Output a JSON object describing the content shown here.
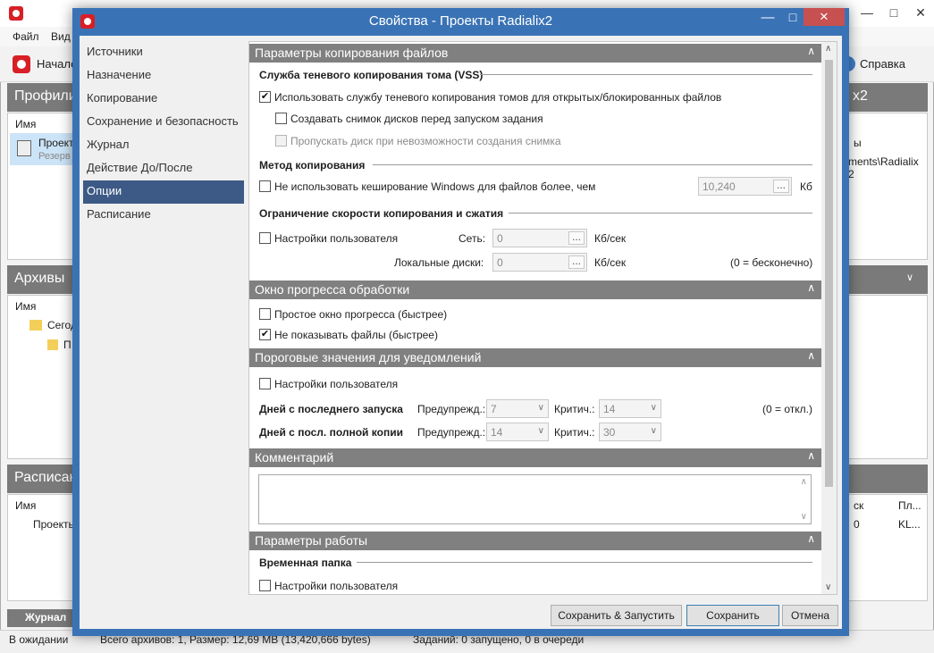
{
  "background": {
    "menu": [
      "Файл",
      "Вид"
    ],
    "toolbar": {
      "start": "Начало",
      "help": "Справка"
    },
    "profiles": {
      "header": "Профили",
      "header_tail": "x2",
      "col_name": "Имя",
      "item_name": "Проект",
      "item_sub": "Резерв",
      "right_col1": "ы",
      "right_col2": "ments\\Radialix 2"
    },
    "archives": {
      "header": "Архивы",
      "col_name": "Имя",
      "tree_item1": "Сегод",
      "tree_item2": "П"
    },
    "schedule": {
      "header": "Расписан",
      "col_name": "Имя",
      "item": "Проекть",
      "right_col1": "ск",
      "right_col2": "Пл...",
      "right_val1": "0",
      "right_val2": "KL..."
    },
    "journal": "Журнал",
    "status": {
      "left": "В ожидании",
      "mid": "Всего архивов: 1, Размер: 12,69 MB (13,420,666 bytes)",
      "right": "Заданий: 0 запущено, 0 в очереди"
    }
  },
  "dialog": {
    "title": "Свойства - Проекты Radialix2",
    "nav": [
      "Источники",
      "Назначение",
      "Копирование",
      "Сохранение и безопасность",
      "Журнал",
      "Действие До/После",
      "Опции",
      "Расписание"
    ],
    "active_nav": "Опции",
    "sections": {
      "copy_params": "Параметры копирования файлов",
      "vss_sub": "Служба теневого копирования тома (VSS)",
      "vss_use": "Использовать службу теневого копирования томов для открытых/блокированных файлов",
      "vss_snapshot": "Создавать снимок дисков перед запуском задания",
      "vss_skip": "Пропускать диск при невозможности создания снимка",
      "method_sub": "Метод копирования",
      "nocache": "Не использовать кеширование Windows для файлов более, чем",
      "nocache_value": "10,240",
      "nocache_unit": "Кб",
      "speed_sub": "Ограничение скорости копирования и сжатия",
      "speed_user": "Настройки пользователя",
      "net_label": "Сеть:",
      "net_value": "0",
      "net_unit": "Кб/сек",
      "local_label": "Локальные диски:",
      "local_value": "0",
      "local_unit": "Кб/сек",
      "zero_inf": "(0 = бесконечно)",
      "progress": "Окно прогресса обработки",
      "simple_progress": "Простое окно прогресса (быстрее)",
      "hide_files": "Не показывать файлы (быстрее)",
      "thresholds": "Пороговые значения для уведомлений",
      "thr_user": "Настройки пользователя",
      "days_last_run": "Дней с последнего запуска",
      "days_full": "Дней с посл. полной копии",
      "warn_label": "Предупрежд.:",
      "crit_label": "Критич.:",
      "warn1": "7",
      "crit1": "14",
      "warn2": "14",
      "crit2": "30",
      "zero_off": "(0 = откл.)",
      "comment": "Комментарий",
      "work_params": "Параметры работы",
      "temp_sub": "Временная папка",
      "temp_user": "Настройки пользователя"
    },
    "buttons": {
      "save_run": "Сохранить & Запустить",
      "save": "Сохранить",
      "cancel": "Отмена"
    },
    "checks": {
      "vss_use": true,
      "vss_snapshot": false,
      "vss_skip": false,
      "nocache": false,
      "speed_user": false,
      "simple_progress": false,
      "hide_files": true,
      "thr_user": false,
      "temp_user": false
    }
  }
}
